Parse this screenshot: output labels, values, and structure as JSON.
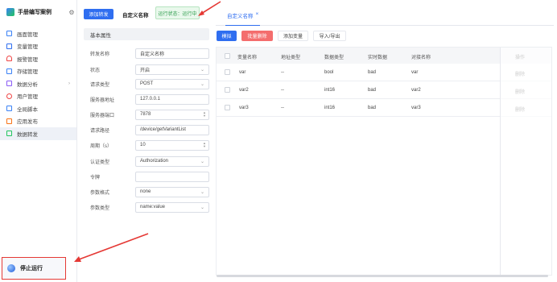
{
  "sidebar": {
    "title": "手册编写案例",
    "items": [
      {
        "label": "画面管理",
        "icon": "screen-icon",
        "color": "#3b82f6"
      },
      {
        "label": "变量管理",
        "icon": "variable-icon",
        "color": "#2f6ef0"
      },
      {
        "label": "报警管理",
        "icon": "bell-icon",
        "color": "#ef4444"
      },
      {
        "label": "存储管理",
        "icon": "storage-icon",
        "color": "#3b82f6"
      },
      {
        "label": "数据分析",
        "icon": "chart-icon",
        "color": "#8b5cf6"
      },
      {
        "label": "用户管理",
        "icon": "user-icon",
        "color": "#ef4444"
      },
      {
        "label": "全局脚本",
        "icon": "script-icon",
        "color": "#3b82f6"
      },
      {
        "label": "应用发布",
        "icon": "publish-icon",
        "color": "#f97316"
      },
      {
        "label": "数据转发",
        "icon": "forward-icon",
        "color": "#22c55e"
      }
    ],
    "stop_label": "停止运行"
  },
  "toolbar": {
    "add_label": "添加转发",
    "custom_name": "自定义名称",
    "status_text": "运行状态：运行中"
  },
  "form": {
    "header": "基本属性",
    "fields": [
      {
        "label": "转发名称",
        "value": "自定义名称"
      },
      {
        "label": "状态",
        "value": "开启"
      },
      {
        "label": "请求类型",
        "value": "POST"
      },
      {
        "label": "服务器地址",
        "value": "127.0.0.1"
      },
      {
        "label": "服务器端口",
        "value": "7878"
      },
      {
        "label": "请求路径",
        "value": "/device/getVariantList"
      },
      {
        "label": "周期（s）",
        "value": "10"
      },
      {
        "label": "认证类型",
        "value": "Authorization"
      },
      {
        "label": "令牌",
        "value": ""
      },
      {
        "label": "参数格式",
        "value": "none"
      },
      {
        "label": "参数类型",
        "value": "name:value"
      }
    ]
  },
  "tabs": [
    {
      "label": "自定义名称",
      "close": "×"
    }
  ],
  "actions": {
    "simulate": "模拟",
    "batch_delete": "批量删除",
    "add_variable": "添加变量",
    "import_export": "导入/导出"
  },
  "table": {
    "headers": [
      "变量名称",
      "地址类型",
      "数据类型",
      "实时数据",
      "对接名称",
      "操作"
    ],
    "rows": [
      {
        "name": "var",
        "addr": "--",
        "dtype": "bool",
        "rt": "bad",
        "dock": "var",
        "op": "删除"
      },
      {
        "name": "var2",
        "addr": "--",
        "dtype": "int16",
        "rt": "bad",
        "dock": "var2",
        "op": "删除"
      },
      {
        "name": "var3",
        "addr": "--",
        "dtype": "int16",
        "rt": "bad",
        "dock": "var3",
        "op": "删除"
      }
    ]
  },
  "colors": {
    "primary": "#2f6ef0",
    "danger": "#f46d6d",
    "success": "#2e9d4d",
    "annotation": "#e53935"
  }
}
